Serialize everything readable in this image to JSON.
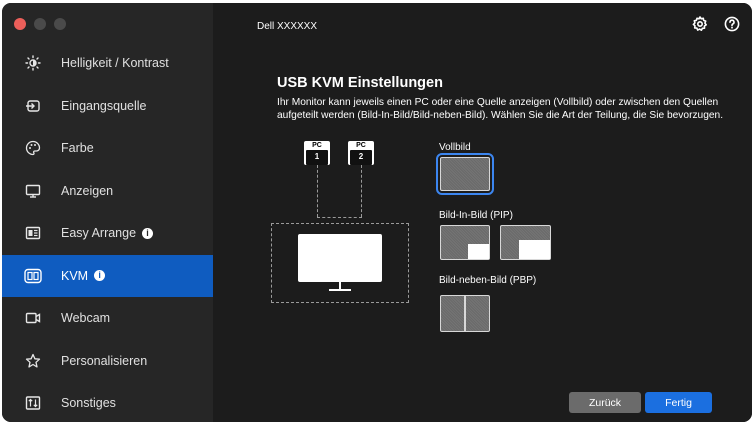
{
  "window": {
    "device_name": "Dell XXXXXX"
  },
  "sidebar": {
    "items": [
      {
        "label": "Helligkeit / Kontrast",
        "icon": "brightness-icon",
        "active": false,
        "info": false
      },
      {
        "label": "Eingangsquelle",
        "icon": "input-source-icon",
        "active": false,
        "info": false
      },
      {
        "label": "Farbe",
        "icon": "color-palette-icon",
        "active": false,
        "info": false
      },
      {
        "label": "Anzeigen",
        "icon": "display-icon",
        "active": false,
        "info": false
      },
      {
        "label": "Easy Arrange",
        "icon": "easy-arrange-icon",
        "active": false,
        "info": true
      },
      {
        "label": "KVM",
        "icon": "kvm-icon",
        "active": true,
        "info": true
      },
      {
        "label": "Webcam",
        "icon": "webcam-icon",
        "active": false,
        "info": false
      },
      {
        "label": "Personalisieren",
        "icon": "star-icon",
        "active": false,
        "info": false
      },
      {
        "label": "Sonstiges",
        "icon": "others-icon",
        "active": false,
        "info": false
      }
    ]
  },
  "main": {
    "title": "USB KVM Einstellungen",
    "description": "Ihr Monitor kann jeweils einen PC oder eine Quelle anzeigen (Vollbild) oder zwischen den Quellen aufgeteilt werden (Bild-In-Bild/Bild-neben-Bild). Wählen Sie die Art der Teilung, die Sie bevorzugen.",
    "diagram": {
      "pc1_tag": "PC",
      "pc1_num": "1",
      "pc2_tag": "PC",
      "pc2_num": "2"
    },
    "options": {
      "full_label": "Vollbild",
      "pip_label": "Bild-In-Bild (PIP)",
      "pbp_label": "Bild-neben-Bild (PBP)",
      "selected": "Vollbild"
    },
    "buttons": {
      "back": "Zurück",
      "done": "Fertig"
    }
  },
  "colors": {
    "accent": "#0f5cc0",
    "button_primary": "#1b6fe0",
    "button_secondary": "#6b6b6b",
    "sidebar_bg": "#262626",
    "main_bg": "#1c1c1c"
  }
}
